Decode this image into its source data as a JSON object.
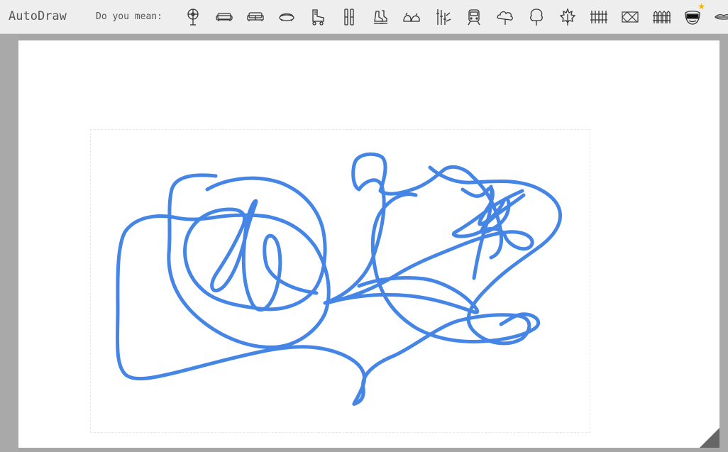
{
  "app": {
    "title": "AutoDraw"
  },
  "suggestions": {
    "label": "Do you mean:",
    "items": [
      {
        "icon": "fan-icon"
      },
      {
        "icon": "couch-icon"
      },
      {
        "icon": "sofa-icon"
      },
      {
        "icon": "loveseat-icon"
      },
      {
        "icon": "roller-skate-icon"
      },
      {
        "icon": "skis-icon"
      },
      {
        "icon": "ice-skates-icon"
      },
      {
        "icon": "animals-icon"
      },
      {
        "icon": "bamboo-icon"
      },
      {
        "icon": "train-icon"
      },
      {
        "icon": "cloud-tree-icon"
      },
      {
        "icon": "tree-icon"
      },
      {
        "icon": "maple-leaf-icon"
      },
      {
        "icon": "fence-icon"
      },
      {
        "icon": "lattice-fence-icon"
      },
      {
        "icon": "picket-fence-icon"
      },
      {
        "icon": "mouth-icon",
        "featured": true
      },
      {
        "icon": "lips-icon"
      }
    ]
  },
  "colors": {
    "stroke": "#4585e5",
    "toolbar": "#eeeeee",
    "background": "#a6a6a6",
    "canvas": "#ffffff",
    "star": "#f4b400"
  }
}
